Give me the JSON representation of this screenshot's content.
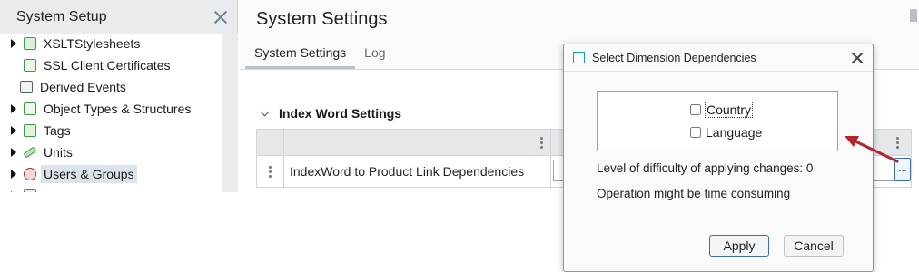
{
  "left_panel": {
    "title": "System Setup",
    "items": [
      {
        "label": "XSLTStylesheets",
        "icon": "stylesheet-icon",
        "expandable": true
      },
      {
        "label": "SSL Client Certificates",
        "icon": "certificate-icon",
        "expandable": false
      },
      {
        "label": "Derived Events",
        "icon": "events-icon",
        "expandable": false
      },
      {
        "label": "Object Types & Structures",
        "icon": "object-types-icon",
        "expandable": true
      },
      {
        "label": "Tags",
        "icon": "tags-icon",
        "expandable": true
      },
      {
        "label": "Units",
        "icon": "units-icon",
        "expandable": true
      },
      {
        "label": "Users & Groups",
        "icon": "users-icon",
        "expandable": true,
        "selected": true
      }
    ]
  },
  "main": {
    "title": "System Settings",
    "tabs": [
      {
        "label": "System Settings",
        "active": true
      },
      {
        "label": "Log",
        "active": false
      }
    ],
    "section": {
      "title": "Index Word Settings",
      "rows": [
        {
          "label": "IndexWord to Product Link Dependencies",
          "button": "..."
        }
      ]
    }
  },
  "dialog": {
    "title": "Select Dimension Dependencies",
    "options": [
      {
        "label": "Country",
        "checked": false
      },
      {
        "label": "Language",
        "checked": false
      }
    ],
    "difficulty_text": "Level of difficulty of applying changes: 0",
    "warning_text": "Operation might be time consuming",
    "apply_label": "Apply",
    "cancel_label": "Cancel"
  },
  "colors": {
    "annotation_arrow": "#b3262e",
    "dialog_accent": "#17a0b5",
    "primary_border": "#3f6fa3"
  }
}
